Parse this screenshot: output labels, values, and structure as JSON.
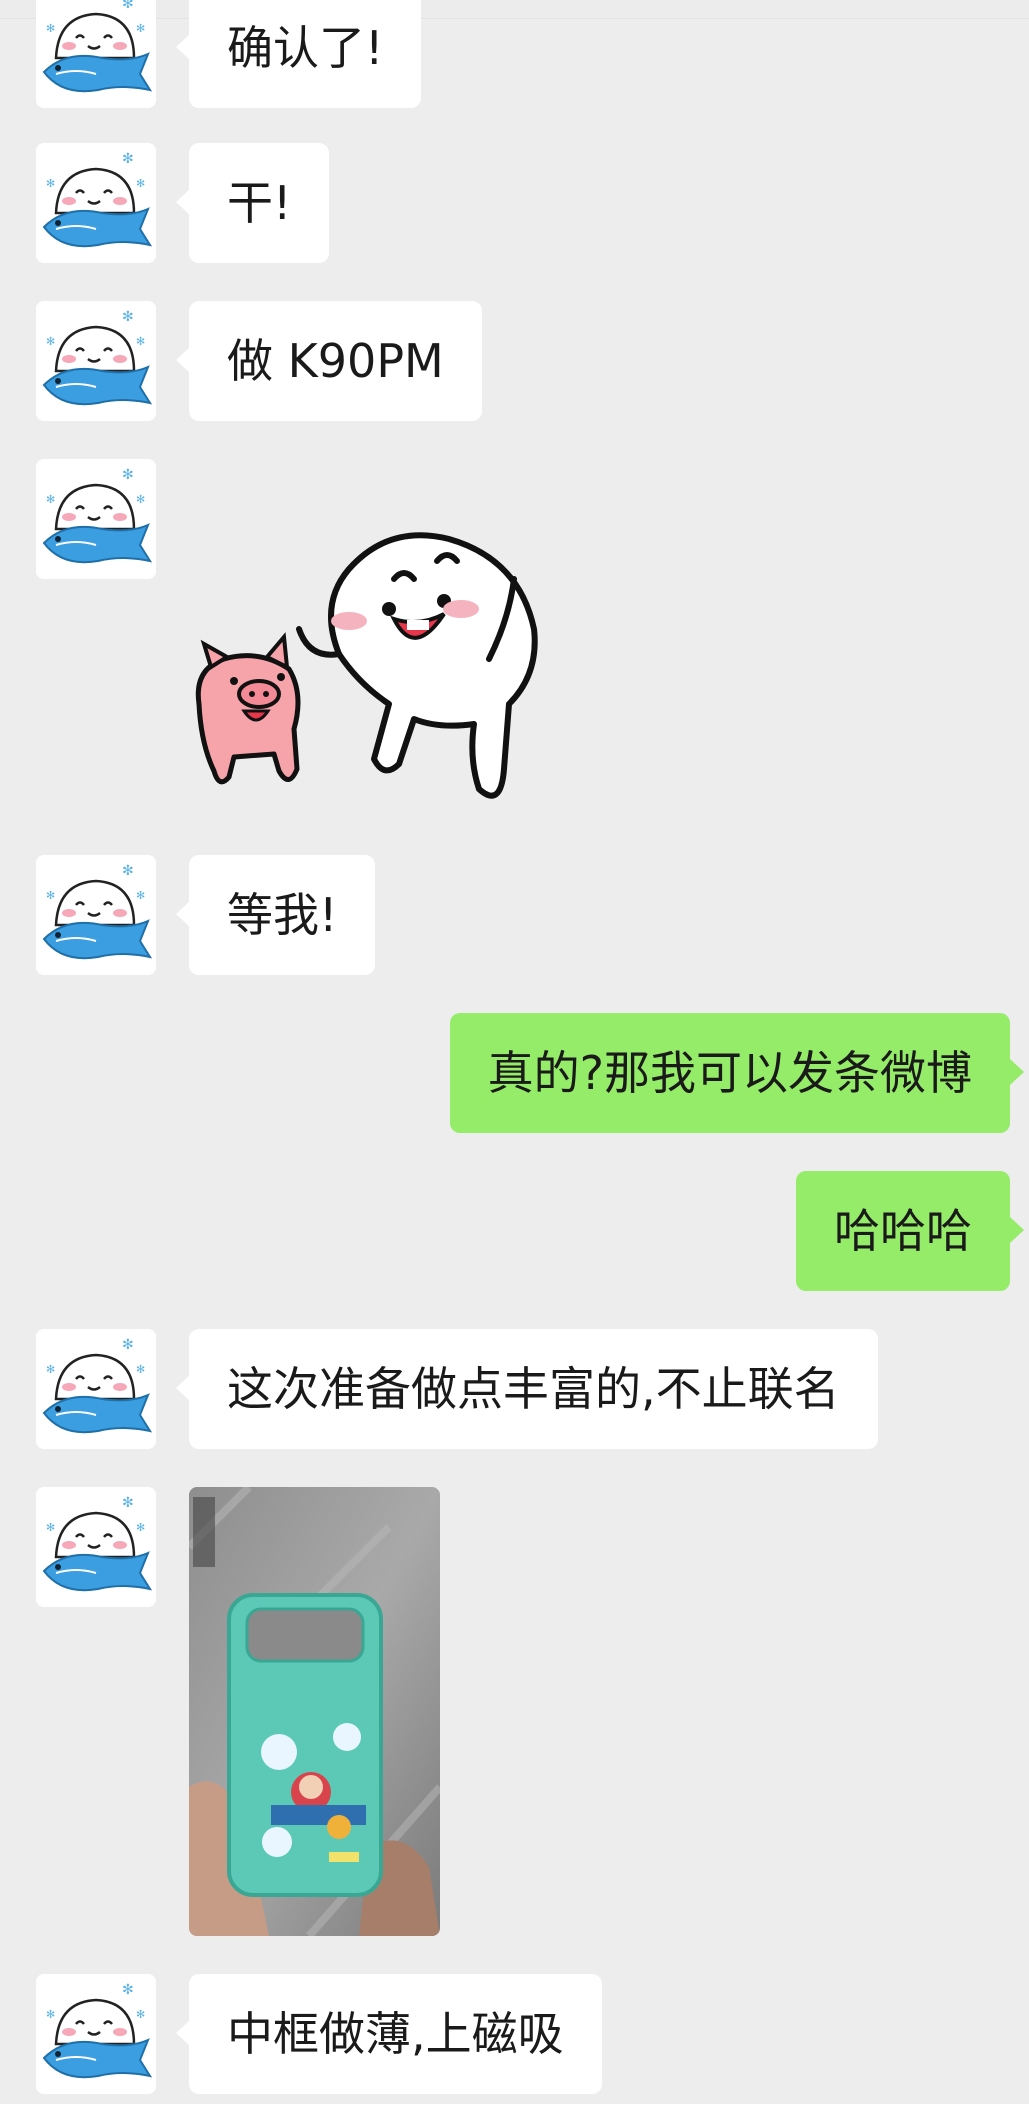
{
  "messages": [
    {
      "side": "left",
      "type": "text",
      "text": "确认了!"
    },
    {
      "side": "left",
      "type": "text",
      "text": "干!"
    },
    {
      "side": "left",
      "type": "text",
      "text": "做 K90PM"
    },
    {
      "side": "left",
      "type": "sticker",
      "icon": "laughing-dumpling-and-pig-sticker"
    },
    {
      "side": "left",
      "type": "text",
      "text": "等我!"
    },
    {
      "side": "right",
      "type": "text",
      "text": "真的?那我可以发条微博"
    },
    {
      "side": "right",
      "type": "text",
      "text": "哈哈哈"
    },
    {
      "side": "left",
      "type": "text",
      "text": "这次准备做点丰富的,不止联名"
    },
    {
      "side": "left",
      "type": "image",
      "icon": "phone-case-photo"
    },
    {
      "side": "left",
      "type": "text",
      "text": "中框做薄,上磁吸"
    }
  ],
  "colors": {
    "background": "#ededed",
    "incoming_bubble": "#ffffff",
    "outgoing_bubble": "#95ec69",
    "text": "#1a1a1a"
  }
}
